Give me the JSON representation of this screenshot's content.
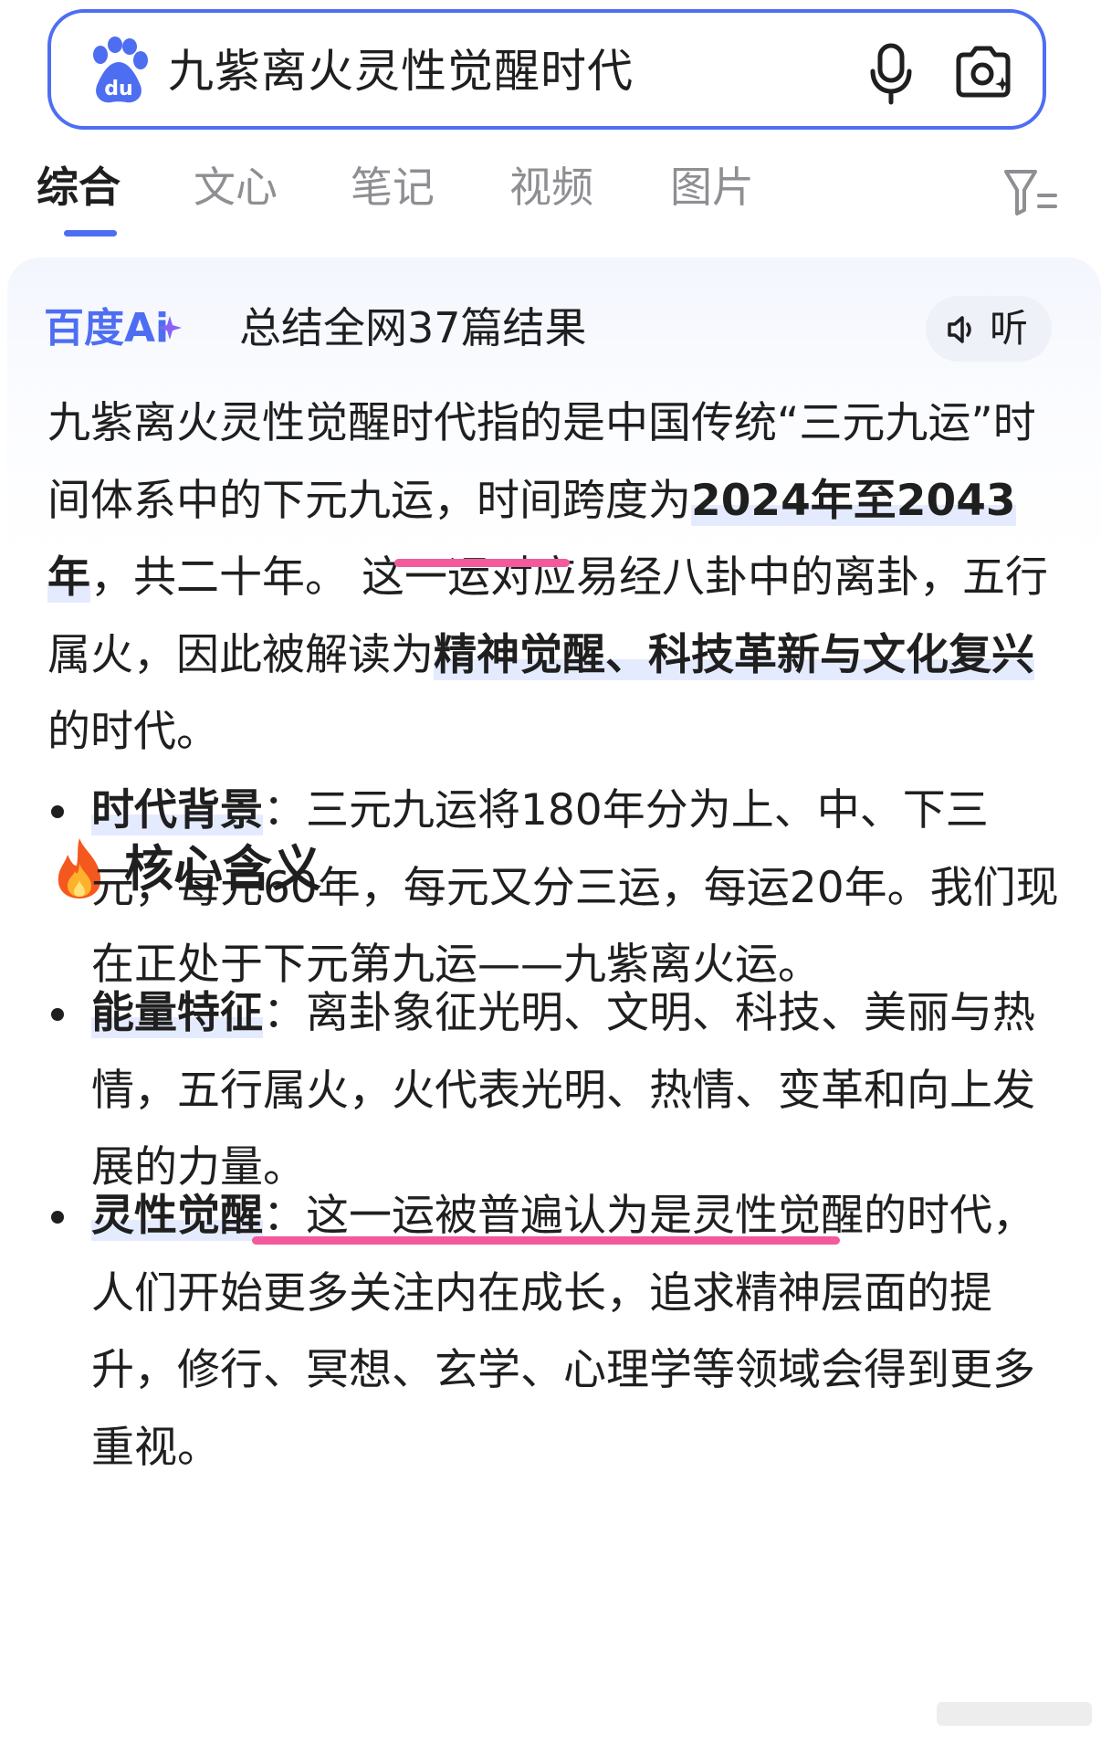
{
  "search": {
    "query": "九紫离火灵性觉醒时代",
    "logo_icon": "baidu-paw-icon",
    "voice_icon": "microphone-icon",
    "camera_icon": "camera-search-icon"
  },
  "tabs": [
    {
      "label": "综合",
      "active": true
    },
    {
      "label": "文心"
    },
    {
      "label": "笔记"
    },
    {
      "label": "视频"
    },
    {
      "label": "图片"
    }
  ],
  "filter_icon": "filter-icon",
  "ai_card": {
    "brand": "百度Ai",
    "summary": "总结全网37篇结果",
    "listen_label": "听",
    "listen_icon": "speaker-icon",
    "intro": {
      "part1": "九紫离火灵性觉醒时代指的是中国传统“三元九运”时间体系中的下元九运，时间跨度为",
      "highlight1": "2024年至2043年",
      "part2": "，共二十年。 这一运对应易经八卦中的离卦，五行属火，因此被解读为",
      "highlight2": "精神觉醒、科技革新与文化复兴",
      "part3": "的时代。"
    },
    "section_heading": "核心含义",
    "section_icon": "fire-icon",
    "bullets": [
      {
        "term": "时代背景",
        "sep": "：",
        "text": "三元九运将180年分为上、中、下三元，每元60年，每元又分三运，每运20年。我们现在正处于下元第九运——九紫离火运。"
      },
      {
        "term": "能量特征",
        "sep": "：",
        "text": "离卦象征光明、文明、科技、美丽与热情，五行属火，火代表光明、热情、变革和向上发展的力量。"
      },
      {
        "term": "灵性觉醒",
        "sep": "：",
        "text_ul": "这一运被普遍认为是灵性觉醒的时代",
        "text": "，人们开始更多关注内在成长，追求精神层面的提升，修行、冥想、玄学、心理学等领域会得到更多重视。"
      }
    ]
  },
  "colors": {
    "accent": "#4e6ef2",
    "underline_pink": "#f25a9b",
    "highlight_bg": "#e5ebff"
  }
}
